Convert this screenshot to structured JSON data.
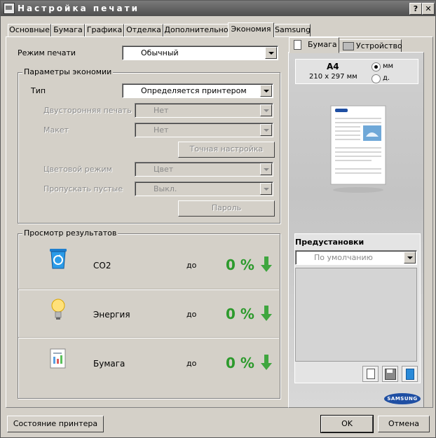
{
  "window": {
    "title": "Настройка печати",
    "help_btn": "?",
    "close_btn": "✕"
  },
  "tabs": [
    "Основные",
    "Бумага",
    "Графика",
    "Отделка",
    "Дополнительно",
    "Экономия",
    "Samsung"
  ],
  "print_mode": {
    "label": "Режим печати",
    "value": "Обычный"
  },
  "economy": {
    "group_title": "Параметры экономии",
    "type_label": "Тип",
    "type_value": "Определяется принтером",
    "duplex_label": "Двусторонняя печать",
    "duplex_value": "Нет",
    "layout_label": "Макет",
    "layout_value": "Нет",
    "fine_tune_button": "Точная настройка",
    "color_mode_label": "Цветовой режим",
    "color_mode_value": "Цвет",
    "skip_blank_label": "Пропускать пустые",
    "skip_blank_value": "Выкл.",
    "password_button": "Пароль"
  },
  "results": {
    "group_title": "Просмотр результатов",
    "rows": [
      {
        "name": "CO2",
        "prefix": "до",
        "value": "0 %"
      },
      {
        "name": "Энергия",
        "prefix": "до",
        "value": "0 %"
      },
      {
        "name": "Бумага",
        "prefix": "до",
        "value": "0 %"
      }
    ]
  },
  "right_panel": {
    "tabs": [
      "Бумага",
      "Устройство"
    ],
    "paper_size": "A4",
    "paper_dims": "210 x 297 мм",
    "unit_mm": "мм",
    "unit_in": "д.",
    "unit_selected": "мм",
    "presets_title": "Предустановки",
    "presets_value": "По умолчанию",
    "brand_logo": "SAMSUNG"
  },
  "bottom": {
    "printer_status_button": "Состояние принтера",
    "ok_button": "OK",
    "cancel_button": "Отмена"
  },
  "colors": {
    "title_bar": "#5a5a5a",
    "dialog_bg": "#d4d0c8",
    "percent_green": "#2c9a2c",
    "brand_blue": "#1f4fa3"
  }
}
